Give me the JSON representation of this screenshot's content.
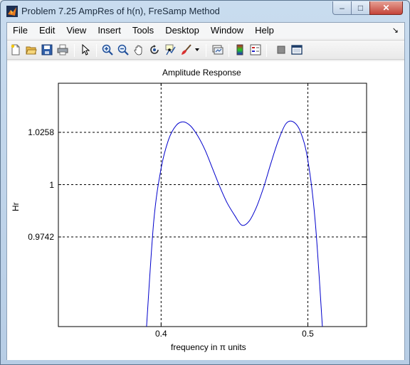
{
  "window": {
    "title": "Problem 7.25 AmpRes of h(n), FreSamp Method",
    "minimize_label": "–",
    "maximize_label": "□",
    "close_label": "✕"
  },
  "menu": {
    "items": [
      "File",
      "Edit",
      "View",
      "Insert",
      "Tools",
      "Desktop",
      "Window",
      "Help"
    ],
    "overflow_arrow": "↘"
  },
  "toolbar": {
    "icons": [
      "new-figure-icon",
      "open-icon",
      "save-icon",
      "print-icon",
      "pointer-icon",
      "zoom-in-icon",
      "zoom-out-icon",
      "pan-icon",
      "rotate-icon",
      "data-cursor-icon",
      "brush-icon",
      "link-plot-icon",
      "colorbar-icon",
      "legend-icon",
      "hide-plot-tools-icon",
      "show-plot-tools-icon"
    ]
  },
  "chart_data": {
    "type": "line",
    "title": "Amplitude Response",
    "xlabel": "frequency in π units",
    "ylabel": "Hr",
    "xlim": [
      0.33,
      0.54
    ],
    "ylim": [
      0.93,
      1.05
    ],
    "xticks": [
      0.4,
      0.5
    ],
    "xtick_labels": [
      "0.4",
      "0.5"
    ],
    "yticks": [
      0.9742,
      1,
      1.0258
    ],
    "ytick_labels": [
      "0.9742",
      "1",
      "1.0258"
    ],
    "grid": true,
    "grid_style": "dashed",
    "line_color": "#0000cc",
    "series": [
      {
        "x": [
          0.39,
          0.395,
          0.4,
          0.405,
          0.41,
          0.415,
          0.42,
          0.425,
          0.43,
          0.435,
          0.44,
          0.445,
          0.45,
          0.455,
          0.46,
          0.465,
          0.47,
          0.475,
          0.48,
          0.485,
          0.49,
          0.495,
          0.5,
          0.505,
          0.51
        ],
        "y": [
          0.929,
          0.982,
          1.008,
          1.022,
          1.029,
          1.031,
          1.029,
          1.024,
          1.017,
          1.008,
          0.999,
          0.991,
          0.985,
          0.98,
          0.982,
          0.989,
          0.999,
          1.011,
          1.022,
          1.03,
          1.031,
          1.026,
          1.012,
          0.982,
          0.929
        ]
      }
    ]
  }
}
